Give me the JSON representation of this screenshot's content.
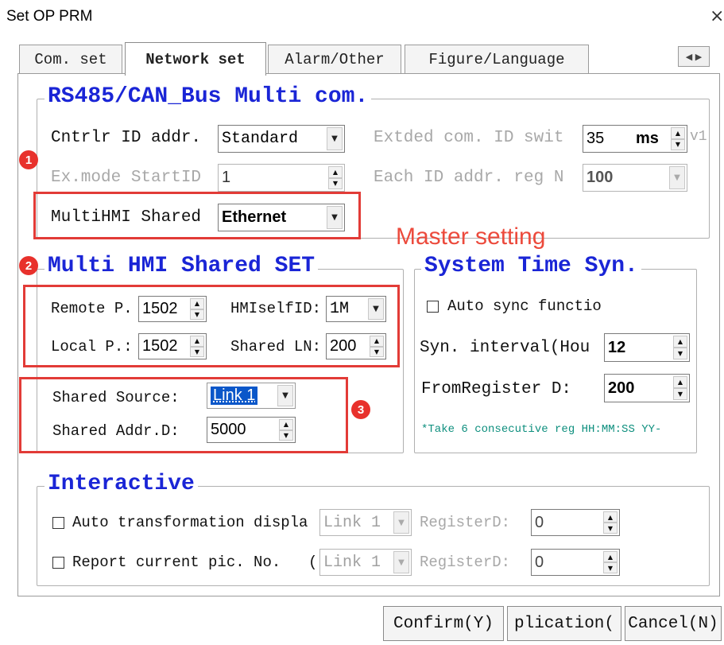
{
  "window": {
    "title": "Set OP PRM",
    "close": "×"
  },
  "tabs": [
    {
      "label": "Com. set"
    },
    {
      "label": "Network set"
    },
    {
      "label": "Alarm/Other"
    },
    {
      "label": "Figure/Language"
    }
  ],
  "tab_scroll": "◀ ▶",
  "rs485": {
    "legend": "RS485/CAN_Bus Multi com.",
    "cntrlr_label": "Cntrlr ID addr.",
    "cntrlr_value": "Standard",
    "extded_label": "Extded com. ID swit",
    "extded_value": "35",
    "extded_unit": "ms",
    "extded_tail": "v1",
    "exmode_label": "Ex.mode StartID",
    "exmode_value": "1",
    "eachid_label": "Each ID addr. reg N",
    "eachid_value": "100",
    "multihmi_label": "MultiHMI Shared",
    "multihmi_value": "Ethernet"
  },
  "shared_set": {
    "legend": "Multi HMI Shared SET",
    "remote_label": "Remote P.",
    "remote_value": "1502",
    "hmiself_label": "HMIselfID:",
    "hmiself_value": "1M",
    "local_label": "Local P.:",
    "local_value": "1502",
    "sharedln_label": "Shared LN:",
    "sharedln_value": "200",
    "source_label": "Shared Source:",
    "source_value": "Link 1",
    "addr_label": "Shared Addr.D:",
    "addr_value": "5000"
  },
  "time_syn": {
    "legend": "System Time Syn.",
    "auto_label": "Auto sync functio",
    "interval_label": "Syn. interval(Hou",
    "interval_value": "12",
    "fromreg_label": "FromRegister D:",
    "fromreg_value": "200",
    "note": "*Take 6 consecutive reg HH:MM:SS YY-"
  },
  "interactive": {
    "legend": "Interactive",
    "auto_label": "Auto transformation displa",
    "auto_link": "Link 1",
    "auto_reg_label": "RegisterD:",
    "auto_reg_value": "0",
    "report_label": "Report current pic. No.",
    "report_paren": "(",
    "report_link": "Link 1",
    "report_reg_label": "RegisterD:",
    "report_reg_value": "0"
  },
  "annotations": {
    "badge1": "1",
    "badge2": "2",
    "badge3": "3",
    "master_setting": "Master setting",
    "color": "#e23b37"
  },
  "buttons": {
    "confirm": "Confirm(Y)",
    "application": "plication(",
    "cancel": "Cancel(N)"
  }
}
